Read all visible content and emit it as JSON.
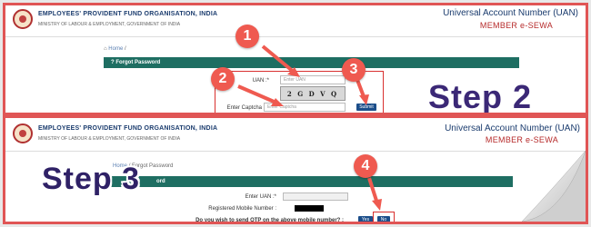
{
  "header": {
    "org_name": "EMPLOYEES' PROVIDENT FUND ORGANISATION, INDIA",
    "ministry": "MINISTRY OF LABOUR & EMPLOYMENT, GOVERNMENT OF INDIA",
    "uan_title": "Universal Account Number (UAN)",
    "member_sewa": "MEMBER e-SEWA"
  },
  "step2": {
    "breadcrumb_home": "Home",
    "breadcrumb_sep": "/",
    "bar_title": "Forgot Password",
    "uan_label": "UAN :*",
    "uan_placeholder": "Enter UAN",
    "captcha_label": "Enter Captcha",
    "captcha_text": "2 G D V Q",
    "captcha_placeholder": "Enter Captcha",
    "submit_label": "Submit",
    "step_label": "Step 2",
    "markers": [
      "1",
      "2",
      "3"
    ]
  },
  "step3": {
    "breadcrumb_home": "Home",
    "breadcrumb_sep": "/",
    "breadcrumb_current": "Forgot Password",
    "bar_title": "ord",
    "uan_label": "Enter UAN :*",
    "mobile_label": "Registered Mobile Number :",
    "otp_question": "Do you wish to send OTP on the above mobile number? :",
    "yes_label": "Yes",
    "no_label": "No",
    "step_label": "Step 3",
    "marker": "4"
  },
  "colors": {
    "frame_border": "#e05555",
    "bar_teal": "#1e6e62",
    "marker_red": "#ef5a50",
    "step_purple": "#3b2876",
    "button_blue": "#1c4e8a"
  }
}
